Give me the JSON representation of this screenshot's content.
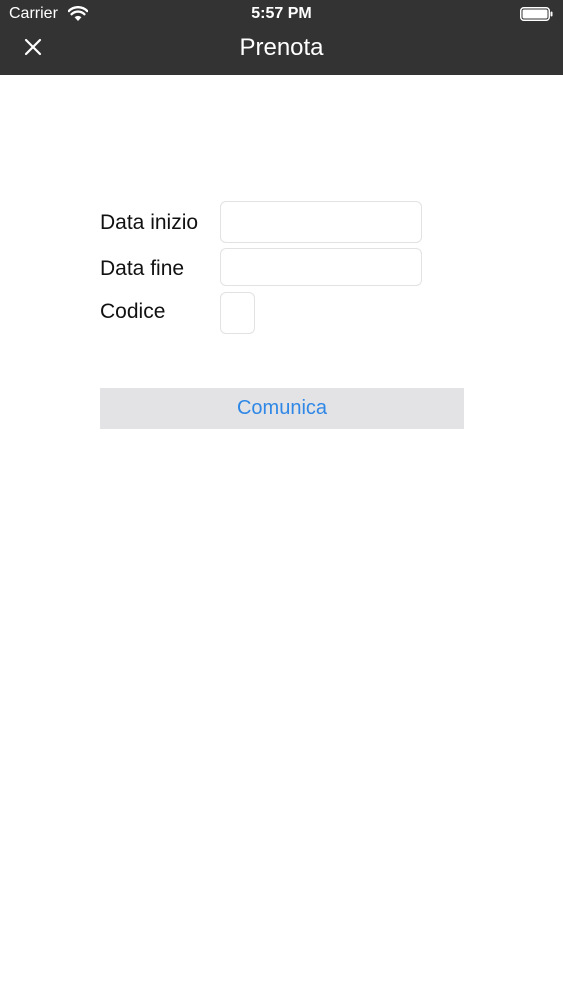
{
  "status_bar": {
    "carrier": "Carrier",
    "time": "5:57 PM",
    "wifi_icon": "wifi-icon",
    "battery_icon": "battery-full-icon"
  },
  "nav": {
    "title": "Prenota",
    "close_icon": "close-icon"
  },
  "form": {
    "start_date": {
      "label": "Data inizio",
      "value": "",
      "placeholder": ""
    },
    "end_date": {
      "label": "Data fine",
      "value": "",
      "placeholder": ""
    },
    "code": {
      "label": "Codice",
      "value": "",
      "placeholder": ""
    }
  },
  "actions": {
    "submit_label": "Comunica"
  },
  "colors": {
    "nav_background": "#333333",
    "accent": "#2f87e6",
    "button_background": "#e3e3e6",
    "input_border": "#e2e2e2"
  }
}
